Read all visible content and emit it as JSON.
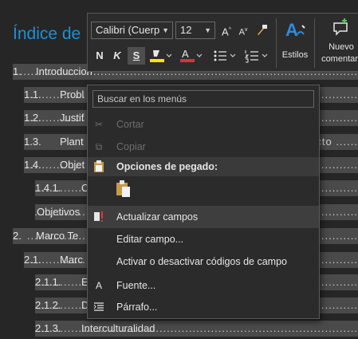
{
  "document": {
    "title": "Índice de",
    "toc": [
      {
        "num": "1.",
        "text": "Introduccion",
        "dots": "................................................................................................"
      },
      {
        "num": "1.1.",
        "text": "Probl",
        "dots": ".........................................................................................."
      },
      {
        "num": "1.2.",
        "text": "Justif",
        "dots": ".........................................................................................."
      },
      {
        "num": "1.3.",
        "text": "Plant",
        "dots": "ecto ......"
      },
      {
        "num": "1.4.",
        "text": "Objet",
        "dots": ".........................................................................................."
      },
      {
        "num": "1.4.1.",
        "text": "O",
        "dots": ".........................................................................................."
      },
      {
        "num": "",
        "text": "Objetivos",
        "dots": ".........................................................................................."
      },
      {
        "num": "2.",
        "text": "Marco Te",
        "dots": ".........................................................................................."
      },
      {
        "num": "2.1.",
        "text": "Marc",
        "dots": ".........................................................................................."
      },
      {
        "num": "2.1.1.",
        "text": "E",
        "dots": ".........................................................................................."
      },
      {
        "num": "2.1.2.",
        "text": "D",
        "dots": ".........................................................................................."
      },
      {
        "num": "2.1.3.",
        "text": "Interculturalidad",
        "dots": ".........................................................................................."
      }
    ]
  },
  "mini_toolbar": {
    "font_name": "Calibri (Cuerp",
    "font_size": "12",
    "grow_font": "A",
    "shrink_font": "A",
    "bold": "N",
    "italic": "K",
    "underline": "S",
    "styles_label": "Estilos",
    "new_comment_label_1": "Nuevo",
    "new_comment_label_2": "comentar",
    "highlight_color": "#f7e600",
    "font_color": "#e03030"
  },
  "context_menu": {
    "search_placeholder": "Buscar en los menús",
    "items": {
      "cut": "Cortar",
      "copy": "Copiar",
      "paste_options": "Opciones de pegado:",
      "update_fields": "Actualizar campos",
      "edit_field": "Editar campo...",
      "toggle_codes": "Activar o desactivar códigos de campo",
      "font": "Fuente...",
      "paragraph": "Párrafo..."
    }
  }
}
